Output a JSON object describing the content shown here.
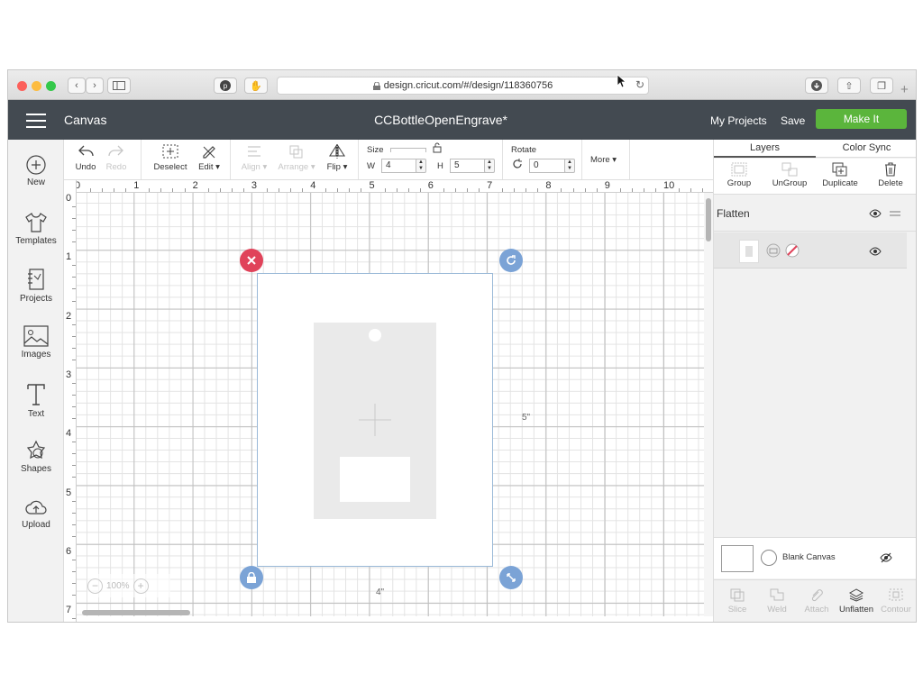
{
  "browser": {
    "url": "design.cricut.com/#/design/118360756",
    "colors": {
      "close": "#fc605b",
      "minimize": "#fdbc40",
      "zoom": "#34c84a"
    }
  },
  "header": {
    "app_title": "Canvas",
    "project_name": "CCBottleOpenEngrave*",
    "my_projects": "My Projects",
    "save": "Save",
    "make_it": "Make It",
    "accent": "#5bb53c"
  },
  "sidebar": {
    "items": [
      {
        "label": "New",
        "icon": "plus-circle-icon"
      },
      {
        "label": "Templates",
        "icon": "tshirt-icon"
      },
      {
        "label": "Projects",
        "icon": "notebook-icon"
      },
      {
        "label": "Images",
        "icon": "image-icon"
      },
      {
        "label": "Text",
        "icon": "text-icon"
      },
      {
        "label": "Shapes",
        "icon": "shapes-icon"
      },
      {
        "label": "Upload",
        "icon": "cloud-upload-icon"
      }
    ]
  },
  "toolbar": {
    "undo": "Undo",
    "redo": "Redo",
    "deselect": "Deselect",
    "edit": "Edit",
    "align": "Align",
    "arrange": "Arrange",
    "flip": "Flip",
    "size_label": "Size",
    "w_label": "W",
    "w_value": "4",
    "h_label": "H",
    "h_value": "5",
    "rotate_label": "Rotate",
    "rotate_value": "0",
    "more": "More"
  },
  "canvas": {
    "ruler_x": [
      "0",
      "1",
      "2",
      "3",
      "4",
      "5",
      "6",
      "7",
      "8",
      "9",
      "10"
    ],
    "ruler_y": [
      "0",
      "1",
      "2",
      "3",
      "4",
      "5",
      "6",
      "7"
    ],
    "width_label": "4\"",
    "height_label": "5\"",
    "zoom": "100%",
    "handle_colors": {
      "delete": "#e0435a",
      "other": "#7ba3d6"
    }
  },
  "layers_panel": {
    "tabs": [
      "Layers",
      "Color Sync"
    ],
    "tools": [
      "Group",
      "UnGroup",
      "Duplicate",
      "Delete"
    ],
    "group_name": "Flatten",
    "blank_canvas": "Blank Canvas",
    "bottom_tools": [
      "Slice",
      "Weld",
      "Attach",
      "Unflatten",
      "Contour"
    ]
  }
}
